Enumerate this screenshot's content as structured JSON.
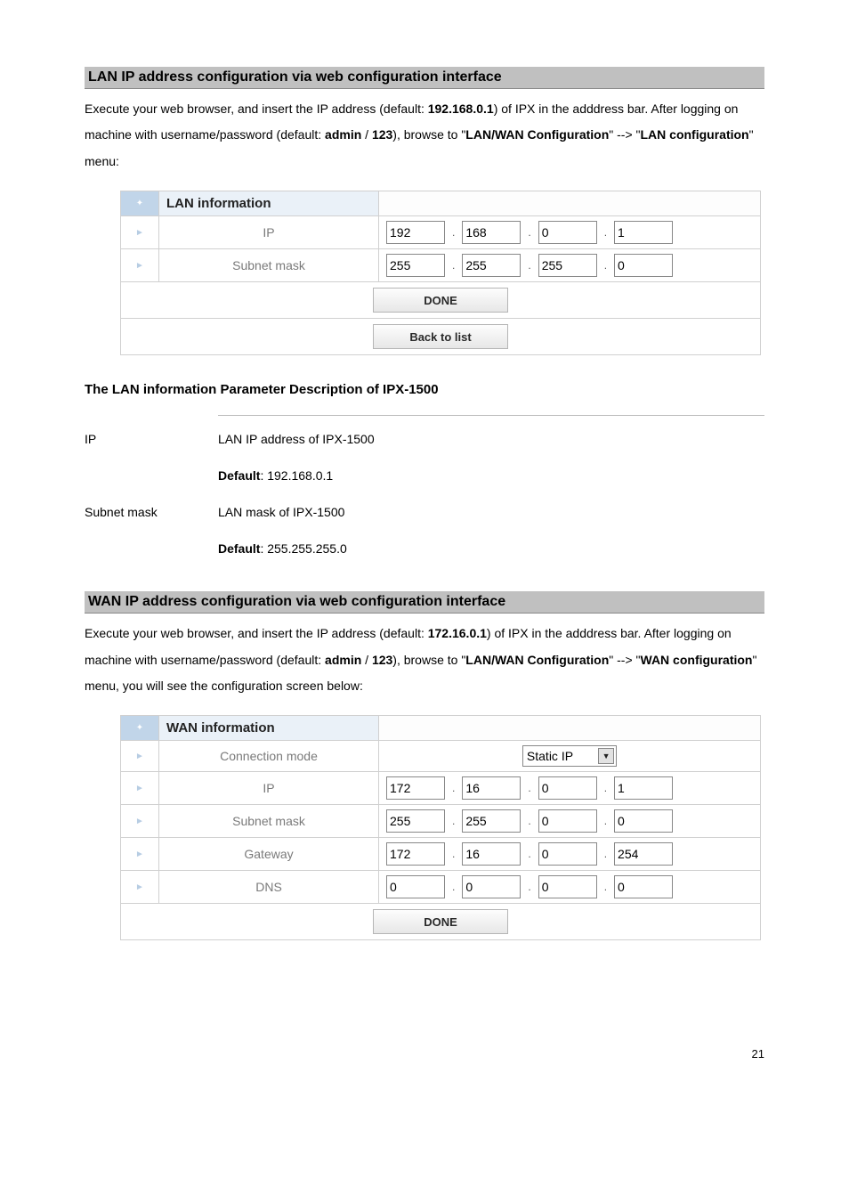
{
  "page_number": "21",
  "lan": {
    "heading": "LAN IP address configuration via web configuration interface",
    "para_parts": [
      "Execute your web browser, and insert the IP address (default: ",
      "192.168.0.1",
      ") of IPX in the adddress bar. After logging on machine with username/password (default: ",
      "admin",
      " / ",
      "123",
      "), browse to \"",
      "LAN/WAN Configuration",
      "\" --> \"",
      "LAN configuration",
      "\" menu:"
    ],
    "table_title": "LAN information",
    "rows": [
      {
        "label": "IP",
        "octets": [
          "192",
          "168",
          "0",
          "1"
        ]
      },
      {
        "label": "Subnet mask",
        "octets": [
          "255",
          "255",
          "255",
          "0"
        ]
      }
    ],
    "buttons": [
      "DONE",
      "Back to list"
    ]
  },
  "params": {
    "heading": "The LAN information Parameter Description of IPX-1500",
    "rows": [
      {
        "label": "IP",
        "desc": "LAN IP address of IPX-1500",
        "default_label": "Default",
        "default_value": ": 192.168.0.1"
      },
      {
        "label": "Subnet mask",
        "desc": "LAN mask of IPX-1500",
        "default_label": "Default",
        "default_value": ": 255.255.255.0"
      }
    ]
  },
  "wan": {
    "heading": "WAN IP address configuration via web configuration interface",
    "para_parts": [
      "Execute your web browser, and insert the IP address (default: ",
      "172.16.0.1",
      ") of IPX in the adddress bar. After logging on machine with username/password (default: ",
      "admin",
      " / ",
      "123",
      "), browse to \"",
      "LAN/WAN Configuration",
      "\" --> \"",
      "WAN configuration",
      "\" menu, you will see the configuration screen below:"
    ],
    "table_title": "WAN information",
    "conn_label": "Connection mode",
    "conn_value": "Static IP",
    "rows": [
      {
        "label": "IP",
        "octets": [
          "172",
          "16",
          "0",
          "1"
        ]
      },
      {
        "label": "Subnet mask",
        "octets": [
          "255",
          "255",
          "0",
          "0"
        ]
      },
      {
        "label": "Gateway",
        "octets": [
          "172",
          "16",
          "0",
          "254"
        ]
      },
      {
        "label": "DNS",
        "octets": [
          "0",
          "0",
          "0",
          "0"
        ]
      }
    ],
    "buttons": [
      "DONE"
    ]
  }
}
